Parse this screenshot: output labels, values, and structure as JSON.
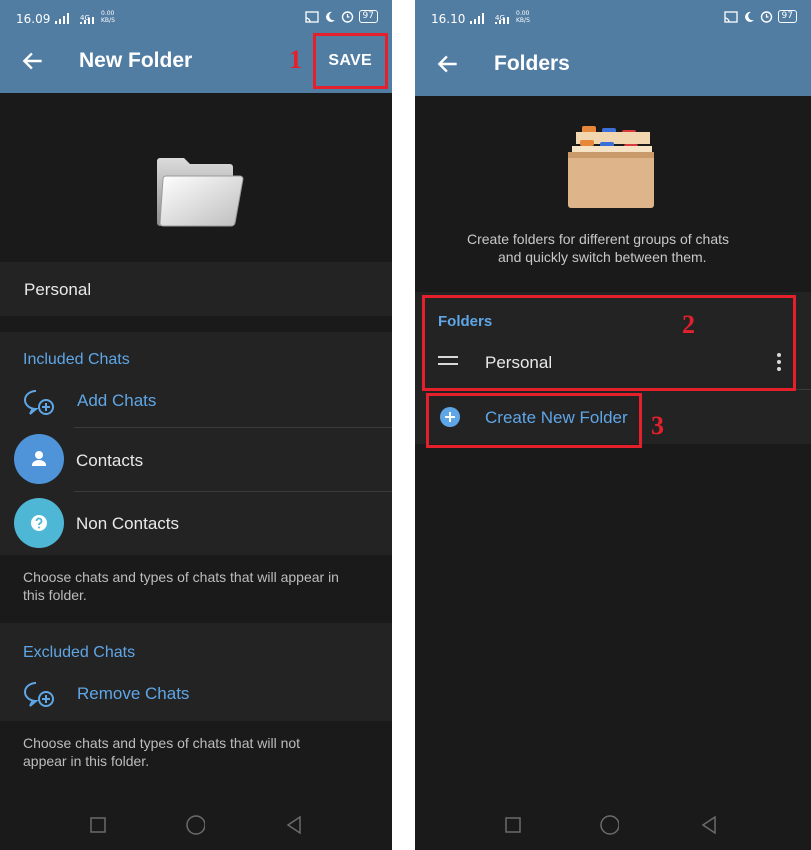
{
  "left": {
    "status": {
      "time": "16.09",
      "net": "4G",
      "speed_top": "0.00",
      "speed_bot": "KB/S",
      "battery": "97"
    },
    "toolbar": {
      "title": "New Folder",
      "save": "SAVE"
    },
    "folder_name": "Personal",
    "included": {
      "header": "Included Chats",
      "add": "Add Chats",
      "items": [
        "Contacts",
        "Non Contacts"
      ],
      "note_line1": "Choose chats and types of chats that will appear in",
      "note_line2": "this folder."
    },
    "excluded": {
      "header": "Excluded Chats",
      "remove": "Remove Chats",
      "note_line1": "Choose chats and types of chats that will not",
      "note_line2": "appear in this folder."
    }
  },
  "right": {
    "status": {
      "time": "16.10",
      "net": "4G",
      "speed_top": "0.00",
      "speed_bot": "KB/S",
      "battery": "97"
    },
    "toolbar": {
      "title": "Folders"
    },
    "intro_line1": "Create folders for different groups of chats",
    "intro_line2": "and quickly switch between them.",
    "folders_header": "Folders",
    "folder_item": "Personal",
    "create": "Create New Folder"
  },
  "annotations": [
    "1",
    "2",
    "3"
  ],
  "colors": {
    "header": "#527da3",
    "accent": "#5fa6e6",
    "background": "#1a1a1a",
    "highlight": "#e3202b"
  }
}
